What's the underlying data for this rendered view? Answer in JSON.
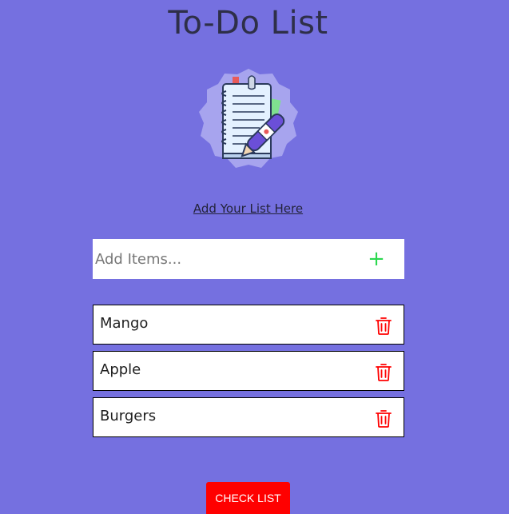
{
  "header": {
    "title": "To-Do List"
  },
  "illustration": {
    "icon": "notebook-with-pen-icon"
  },
  "add_section": {
    "link_label": "Add Your List Here",
    "input_placeholder": "Add Items...",
    "input_value": "",
    "add_icon": "+"
  },
  "items": [
    {
      "label": "Mango"
    },
    {
      "label": "Apple"
    },
    {
      "label": "Burgers"
    }
  ],
  "footer": {
    "check_label": "CHECK LIST"
  },
  "colors": {
    "background": "#7570e0",
    "title": "#2e2f48",
    "add_icon": "#2bd84f",
    "delete_icon": "#ff0000",
    "check_button": "#ff0000"
  }
}
